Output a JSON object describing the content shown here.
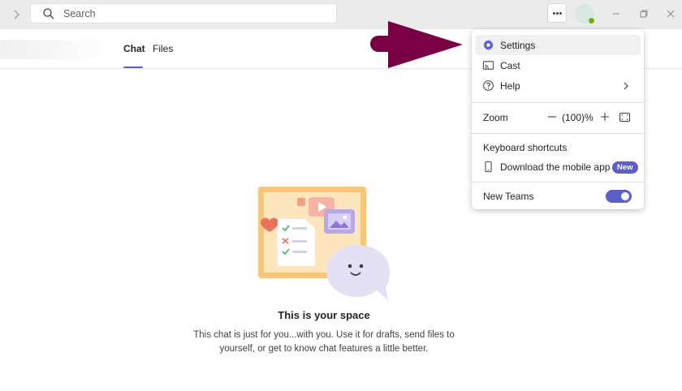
{
  "titlebar": {
    "search_placeholder": "Search",
    "more_label": "More options",
    "icons": [
      "chevron-right-icon",
      "search-icon",
      "more-icon",
      "avatar",
      "minimize-icon",
      "restore-icon",
      "close-icon"
    ]
  },
  "header": {
    "tabs": [
      {
        "label": "Chat",
        "active": true
      },
      {
        "label": "Files",
        "active": false
      }
    ]
  },
  "empty_state": {
    "title": "This is your space",
    "description": "This chat is just for you...with you. Use it for drafts, send files to yourself, or get to know chat features a little better."
  },
  "menu": {
    "items": [
      {
        "label": "Settings",
        "icon": "gear-icon"
      },
      {
        "label": "Cast",
        "icon": "cast-icon"
      },
      {
        "label": "Help",
        "icon": "help-icon"
      }
    ],
    "zoom": {
      "label": "Zoom",
      "value": "(100)%"
    },
    "keyboard_shortcuts": "Keyboard shortcuts",
    "download_app": {
      "label": "Download the mobile app",
      "badge": "New",
      "icon": "phone-icon"
    },
    "new_teams": {
      "label": "New Teams",
      "enabled": true
    }
  },
  "colors": {
    "accent": "#5b5fc7",
    "arrow": "#7a0046",
    "titlebar_bg": "#ebebeb",
    "presence": "#6bb700"
  }
}
